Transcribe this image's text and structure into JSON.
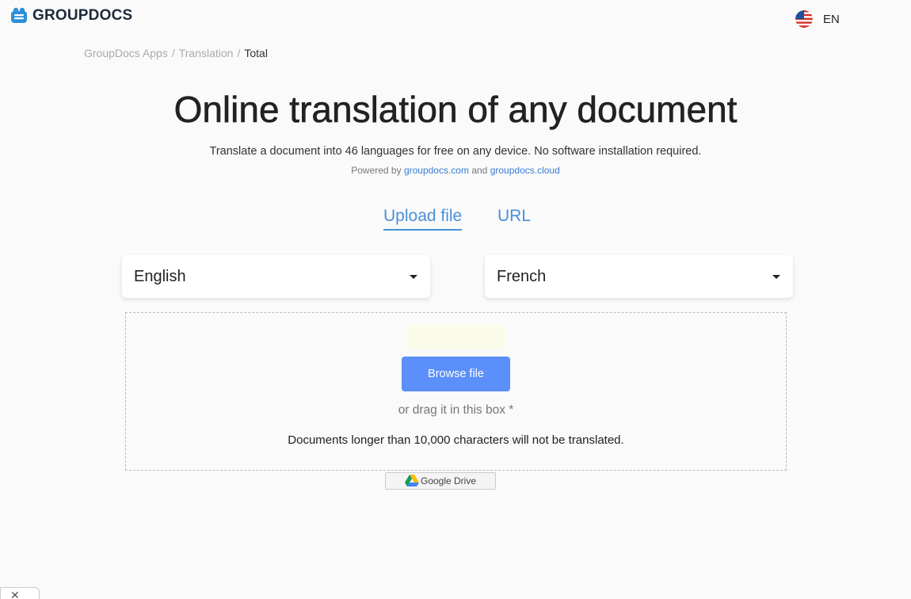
{
  "header": {
    "logo_text": "GROUPDOCS",
    "logo_icon": "groupdocs-logo-icon",
    "language": "EN",
    "flag_icon": "us-flag-icon"
  },
  "breadcrumb": {
    "items": [
      "GroupDocs Apps",
      "Translation",
      "Total"
    ]
  },
  "hero": {
    "title": "Online translation of any document",
    "subtitle": "Translate a document into 46 languages for free on any device. No software installation required.",
    "powered_prefix": "Powered by",
    "powered_link1": "groupdocs.com",
    "powered_and": "and",
    "powered_link2": "groupdocs.cloud"
  },
  "tabs": [
    {
      "label": "Upload file",
      "active": true
    },
    {
      "label": "URL",
      "active": false
    }
  ],
  "languages": {
    "source": "English",
    "target": "French"
  },
  "dropzone": {
    "browse_label": "Browse file",
    "drag_text": "or drag it in this box *",
    "limit_text": "Documents longer than 10,000 characters will not be translated."
  },
  "gdrive": {
    "label": "Google Drive",
    "icon": "google-drive-icon"
  },
  "corner": {
    "close_glyph": "✕"
  },
  "colors": {
    "accent": "#4a90d9",
    "button": "#5b8ff9",
    "background": "#fafafa"
  }
}
